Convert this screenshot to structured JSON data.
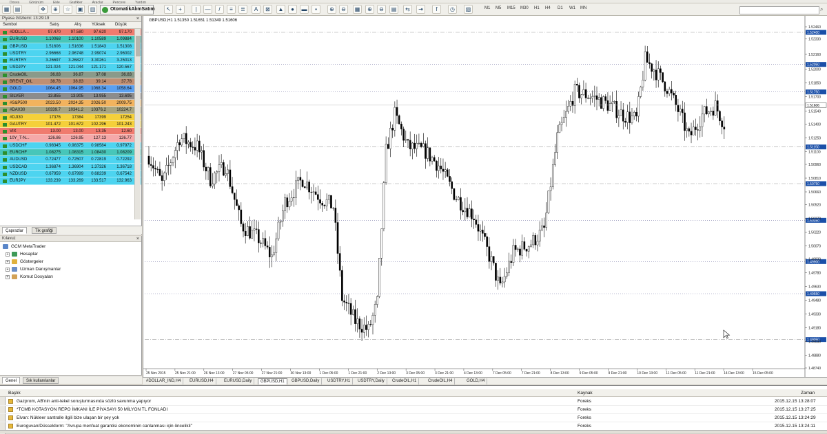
{
  "menubar": [
    "Dosya",
    "Görünüm",
    "Ekle",
    "Grafikler",
    "Araçlar",
    "Pencere",
    "Yardım"
  ],
  "toolbar": {
    "algo_button": "OtomatikAlımSatım",
    "timeframes": [
      "M1",
      "M5",
      "M15",
      "M30",
      "H1",
      "H4",
      "D1",
      "W1",
      "MN"
    ]
  },
  "market_watch": {
    "title": "Piyasa Gözlemi: 13:29:19",
    "columns": [
      "Sembol",
      "Satış",
      "Alış",
      "Yüksek",
      "Düşük"
    ],
    "rows": [
      {
        "symbol": "#DOLLA...",
        "bid": "97.470",
        "ask": "97.580",
        "high": "97.620",
        "low": "97.170",
        "bg": "#f07b6e"
      },
      {
        "symbol": "EURUSD",
        "bid": "1.10068",
        "ask": "1.10100",
        "high": "1.10589",
        "low": "1.09884",
        "bg": "#47c6b9"
      },
      {
        "symbol": "GBPUSD",
        "bid": "1.51606",
        "ask": "1.51636",
        "high": "1.51843",
        "low": "1.51308",
        "bg": "#4dd4f0"
      },
      {
        "symbol": "USDTRY",
        "bid": "2.96668",
        "ask": "2.96748",
        "high": "2.99074",
        "low": "2.96002",
        "bg": "#4dd4f0"
      },
      {
        "symbol": "EURTRY",
        "bid": "3.26697",
        "ask": "3.26827",
        "high": "3.30261",
        "low": "3.25013",
        "bg": "#4dd4f0"
      },
      {
        "symbol": "USDJPY",
        "bid": "121.024",
        "ask": "121.044",
        "high": "121.171",
        "low": "120.567",
        "bg": "#4dd4f0"
      },
      {
        "symbol": "CrudeOIL",
        "bid": "36.83",
        "ask": "36.87",
        "high": "37.08",
        "low": "36.83",
        "bg": "#8a9a8a"
      },
      {
        "symbol": "BRENT_OIL",
        "bid": "38.78",
        "ask": "38.83",
        "high": "39.14",
        "low": "37.78",
        "bg": "#bf8f73"
      },
      {
        "symbol": "GOLD",
        "bid": "1064.45",
        "ask": "1064.95",
        "high": "1068.34",
        "low": "1058.64",
        "bg": "#5aa0f0"
      },
      {
        "symbol": "SILVER",
        "bid": "13.855",
        "ask": "13.905",
        "high": "13.955",
        "low": "13.695",
        "bg": "#8c8c8c"
      },
      {
        "symbol": "#S&P500",
        "bid": "2023.50",
        "ask": "2024.35",
        "high": "2026.50",
        "low": "2009.75",
        "bg": "#f2b35e"
      },
      {
        "symbol": "#DAX30",
        "bid": "10339.7",
        "ask": "10341.2",
        "high": "10376.2",
        "low": "10224.7",
        "bg": "#a8a47e"
      },
      {
        "symbol": "#DJI30",
        "bid": "17376",
        "ask": "17384",
        "high": "17399",
        "low": "17254",
        "bg": "#f5d03a"
      },
      {
        "symbol": "GAUTRY",
        "bid": "101.472",
        "ask": "101.672",
        "high": "102.296",
        "low": "101.243",
        "bg": "#f5d03a"
      },
      {
        "symbol": "VIX",
        "bid": "13.00",
        "ask": "13.00",
        "high": "13.35",
        "low": "12.60",
        "bg": "#f07b6e"
      },
      {
        "symbol": "10Y_T-N...",
        "bid": "126.86",
        "ask": "126.95",
        "high": "127.13",
        "low": "126.77",
        "bg": "#f5a9a9"
      },
      {
        "symbol": "USDCHF",
        "bid": "0.98345",
        "ask": "0.98375",
        "high": "0.98584",
        "low": "0.97972",
        "bg": "#4dd4f0"
      },
      {
        "symbol": "EURCHF",
        "bid": "1.08275",
        "ask": "1.08315",
        "high": "1.08430",
        "low": "1.08209",
        "bg": "#47c6b9"
      },
      {
        "symbol": "AUDUSD",
        "bid": "0.72477",
        "ask": "0.72507",
        "high": "0.72819",
        "low": "0.72292",
        "bg": "#4dd4f0"
      },
      {
        "symbol": "USDCAD",
        "bid": "1.36874",
        "ask": "1.36904",
        "high": "1.37326",
        "low": "1.36718",
        "bg": "#4dd4f0"
      },
      {
        "symbol": "NZDUSD",
        "bid": "0.67959",
        "ask": "0.67999",
        "high": "0.68239",
        "low": "0.67542",
        "bg": "#4dd4f0"
      },
      {
        "symbol": "EURJPY",
        "bid": "133.239",
        "ask": "133.269",
        "high": "133.517",
        "low": "132.963",
        "bg": "#4dd4f0"
      }
    ],
    "tabs": [
      "Çaprazlar",
      "Tik grafiği"
    ]
  },
  "navigator": {
    "title": "Kılavuz",
    "root": "GCM MetaTrader",
    "items": [
      "Hesaplar",
      "Göstergeler",
      "Uzman Danışmanlar",
      "Komut Dosyaları"
    ],
    "tabs": [
      "Genel",
      "Sık kullanılanlar"
    ]
  },
  "chart": {
    "header": "GBPUSD,H1  1.51350 1.51651 1.51349 1.51606",
    "current_price": "1.51606",
    "price_ticks": [
      "1.52460",
      "1.52330",
      "1.52160",
      "1.52000",
      "1.51850",
      "1.51700",
      "1.51540",
      "1.51400",
      "1.51250",
      "1.51100",
      "1.50960",
      "1.50810",
      "1.50660",
      "1.50520",
      "1.50370",
      "1.50220",
      "1.50070",
      "1.49930",
      "1.49780",
      "1.49630",
      "1.49480",
      "1.49330",
      "1.49180",
      "1.49030",
      "1.48880",
      "1.48740"
    ],
    "hlines": [
      {
        "price": "1.52400",
        "style": "dash"
      },
      {
        "price": "1.52050",
        "style": "dot"
      },
      {
        "price": "1.51750",
        "style": "dot"
      },
      {
        "price": "1.51150",
        "style": "dash"
      },
      {
        "price": "1.50750",
        "style": "dash"
      },
      {
        "price": "1.50350",
        "style": "dot"
      },
      {
        "price": "1.49900",
        "style": "dot"
      },
      {
        "price": "1.49550",
        "style": "dot"
      },
      {
        "price": "1.49050",
        "style": "dash"
      }
    ],
    "time_ticks": [
      "25 Nov 2015",
      "25 Nov 21:00",
      "26 Nov 13:00",
      "27 Nov 05:00",
      "27 Nov 21:00",
      "30 Nov 13:00",
      "1 Dec 05:00",
      "1 Dec 21:00",
      "2 Dec 13:00",
      "3 Dec 05:00",
      "3 Dec 21:00",
      "4 Dec 13:00",
      "7 Dec 05:00",
      "7 Dec 21:00",
      "8 Dec 13:00",
      "9 Dec 05:00",
      "9 Dec 21:00",
      "10 Dec 13:00",
      "11 Dec 05:00",
      "11 Dec 21:00",
      "14 Dec 13:00",
      "15 Dec 05:00"
    ]
  },
  "chart_data": {
    "type": "candlestick",
    "symbol": "GBPUSD",
    "timeframe": "H1",
    "ylim": [
      1.4874,
      1.5252
    ],
    "anchors": [
      {
        "i": 0,
        "p": 1.5105
      },
      {
        "i": 6,
        "p": 1.5075
      },
      {
        "i": 14,
        "p": 1.5125
      },
      {
        "i": 22,
        "p": 1.5115
      },
      {
        "i": 28,
        "p": 1.508
      },
      {
        "i": 35,
        "p": 1.5095
      },
      {
        "i": 42,
        "p": 1.503
      },
      {
        "i": 50,
        "p": 1.5015
      },
      {
        "i": 56,
        "p": 1.4995
      },
      {
        "i": 62,
        "p": 1.5055
      },
      {
        "i": 70,
        "p": 1.508
      },
      {
        "i": 78,
        "p": 1.506
      },
      {
        "i": 84,
        "p": 1.505
      },
      {
        "i": 88,
        "p": 1.495
      },
      {
        "i": 94,
        "p": 1.4925
      },
      {
        "i": 100,
        "p": 1.4915
      },
      {
        "i": 104,
        "p": 1.4945
      },
      {
        "i": 108,
        "p": 1.511
      },
      {
        "i": 112,
        "p": 1.515
      },
      {
        "i": 118,
        "p": 1.5115
      },
      {
        "i": 126,
        "p": 1.511
      },
      {
        "i": 132,
        "p": 1.5095
      },
      {
        "i": 140,
        "p": 1.506
      },
      {
        "i": 148,
        "p": 1.504
      },
      {
        "i": 156,
        "p": 1.499
      },
      {
        "i": 160,
        "p": 1.496
      },
      {
        "i": 166,
        "p": 1.5
      },
      {
        "i": 174,
        "p": 1.501
      },
      {
        "i": 180,
        "p": 1.5025
      },
      {
        "i": 186,
        "p": 1.5125
      },
      {
        "i": 194,
        "p": 1.5175
      },
      {
        "i": 202,
        "p": 1.517
      },
      {
        "i": 210,
        "p": 1.516
      },
      {
        "i": 216,
        "p": 1.515
      },
      {
        "i": 222,
        "p": 1.5145
      },
      {
        "i": 226,
        "p": 1.521
      },
      {
        "i": 230,
        "p": 1.52
      },
      {
        "i": 236,
        "p": 1.518
      },
      {
        "i": 242,
        "p": 1.515
      },
      {
        "i": 246,
        "p": 1.5125
      },
      {
        "i": 252,
        "p": 1.515
      },
      {
        "i": 258,
        "p": 1.516
      },
      {
        "i": 262,
        "p": 1.514
      }
    ],
    "n_bars": 263
  },
  "chart_tabs": [
    "#DOLLAR_IND,H4",
    "EURUSD,H4",
    "EURUSD,Daily",
    "GBPUSD,H1",
    "GBPUSD,Daily",
    "USDTRY,H1",
    "USDTRY,Daily",
    "CrudeOIL,H1",
    "CrudeOIL,H4",
    "GOLD,H4"
  ],
  "active_chart_tab": "GBPUSD,H1",
  "news": {
    "columns": [
      "Başlık",
      "Kaynak",
      "Zaman"
    ],
    "rows": [
      {
        "title": "Gazprom, AB'nin anti-tekel soruşturmasında sözlü savunma yapıyor",
        "source": "Foreks",
        "time": "2015.12.15 13:28:07"
      },
      {
        "title": "*TCMB KOTASYON REPO İMKANI İLE PİYASAYI 50 MİLYON TL FONLADI",
        "source": "Foreks",
        "time": "2015.12.15 13:27:25"
      },
      {
        "title": "Elvan: Nükleer santralle ilgili bize ulaşan bir şey yok",
        "source": "Foreks",
        "time": "2015.12.15 13:24:29"
      },
      {
        "title": "Euroguvan/Düsseldorm: \"Avrupa menfuat garantisi ekonominin canlanması için öncelikli\"",
        "source": "Foreks",
        "time": "2015.12.15 13:24:11"
      }
    ]
  },
  "colors": {
    "accent": "#4dd4f0",
    "current_price_bg": "#ffffff",
    "hline_label_bg": "#1a4fa8"
  }
}
